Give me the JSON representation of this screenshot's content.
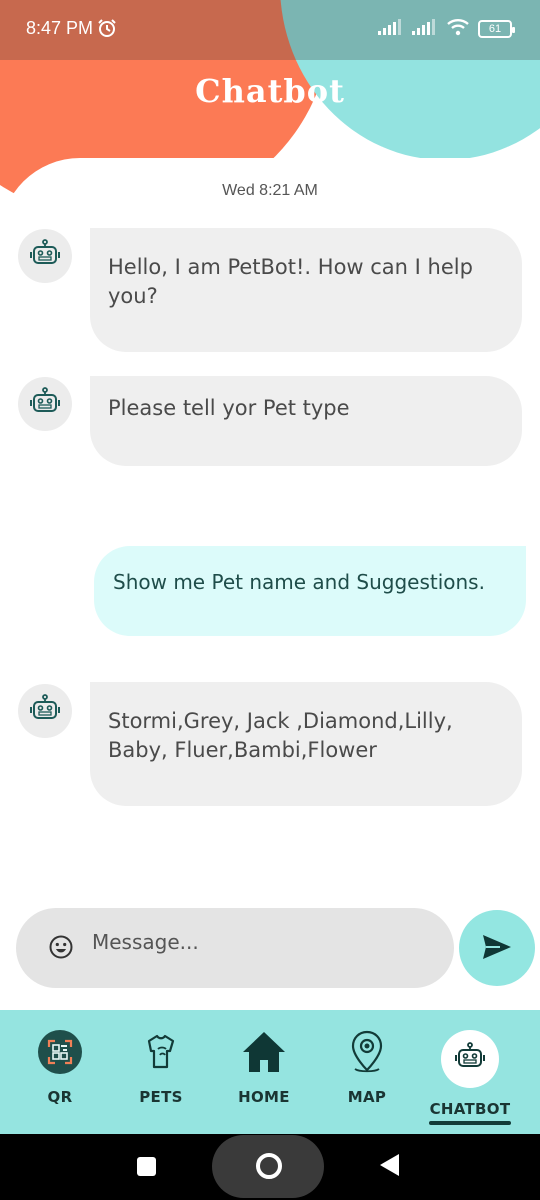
{
  "status_bar": {
    "time": "8:47 PM",
    "battery": "61"
  },
  "header": {
    "title": "Chatbot"
  },
  "chat": {
    "timestamp": "Wed 8:21 AM",
    "messages": [
      {
        "sender": "bot",
        "text": "Hello, I am PetBot!. How can I help you?"
      },
      {
        "sender": "bot",
        "text": "Please tell yor Pet type"
      },
      {
        "sender": "user",
        "text": "Show me Pet name and Suggestions."
      },
      {
        "sender": "bot",
        "text": "Stormi,Grey, Jack ,Diamond,Lilly, Baby, Fluer,Bambi,Flower"
      }
    ]
  },
  "composer": {
    "placeholder": "Message...",
    "value": ""
  },
  "bottom_nav": {
    "items": [
      {
        "label": "QR",
        "icon": "qr-code-icon"
      },
      {
        "label": "PETS",
        "icon": "pet-shirt-icon"
      },
      {
        "label": "HOME",
        "icon": "home-icon"
      },
      {
        "label": "MAP",
        "icon": "map-pin-icon"
      },
      {
        "label": "CHATBOT",
        "icon": "robot-icon",
        "active": true
      }
    ]
  },
  "colors": {
    "accent_orange": "#fc7a55",
    "accent_teal": "#93e3e0",
    "bubble_bot": "#efefef",
    "bubble_user": "#dcfbfa"
  }
}
